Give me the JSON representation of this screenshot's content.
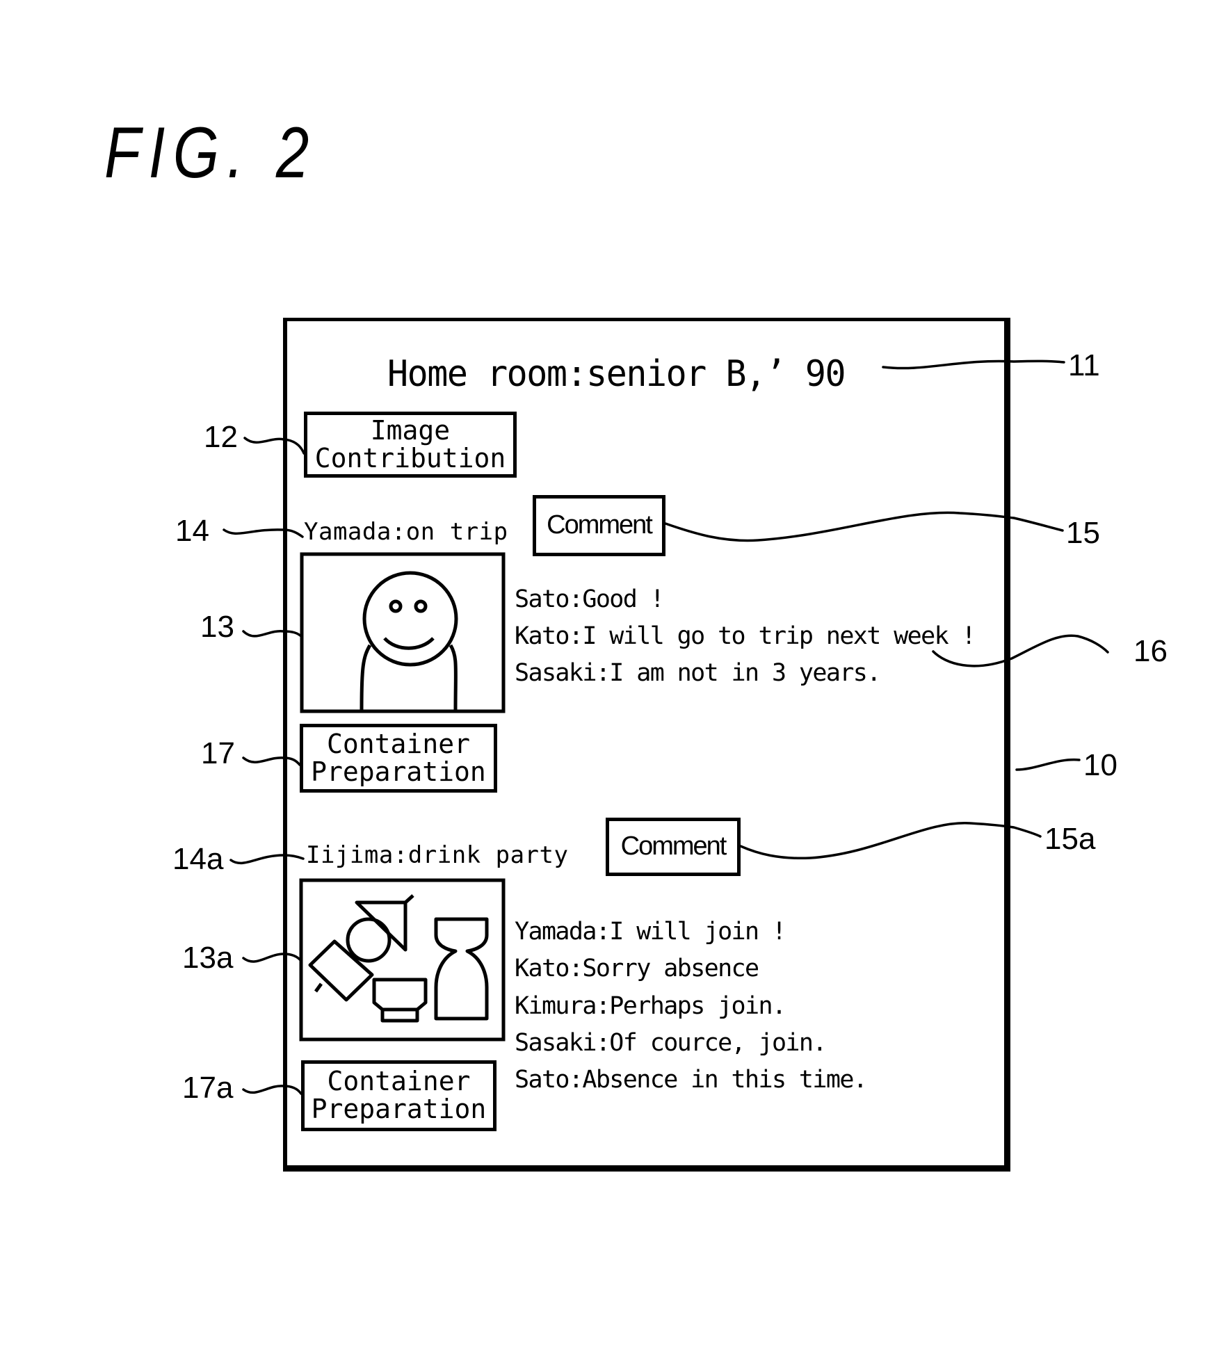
{
  "figure_label": "FIG. 2",
  "screen": {
    "title": "Home room:senior B,’ 90",
    "image_contribution_button": [
      "Image",
      "Contribution"
    ],
    "posts": [
      {
        "title": "Yamada:on trip",
        "image_icon": "smiley-person-icon",
        "comment_button": "Comment",
        "comments": [
          "Sato:Good !",
          "Kato:I will go to trip next week !",
          "Sasaki:I am not in 3 years."
        ],
        "container_button": [
          "Container",
          "Preparation"
        ]
      },
      {
        "title": "Iijima:drink party",
        "image_icon": "drink-party-glasses-icon",
        "comment_button": "Comment",
        "comments": [
          "Yamada:I will join !",
          "Kato:Sorry absence",
          "Kimura:Perhaps join.",
          "Sasaki:Of cource, join.",
          "Sato:Absence in this time."
        ],
        "container_button": [
          "Container",
          "Preparation"
        ]
      }
    ]
  },
  "reference_numerals": {
    "screen": "10",
    "title": "11",
    "image_contribution": "12",
    "image": "13",
    "image_a": "13a",
    "post_title": "14",
    "post_title_a": "14a",
    "comment": "15",
    "comment_a": "15a",
    "comment_list": "16",
    "container": "17",
    "container_a": "17a"
  }
}
